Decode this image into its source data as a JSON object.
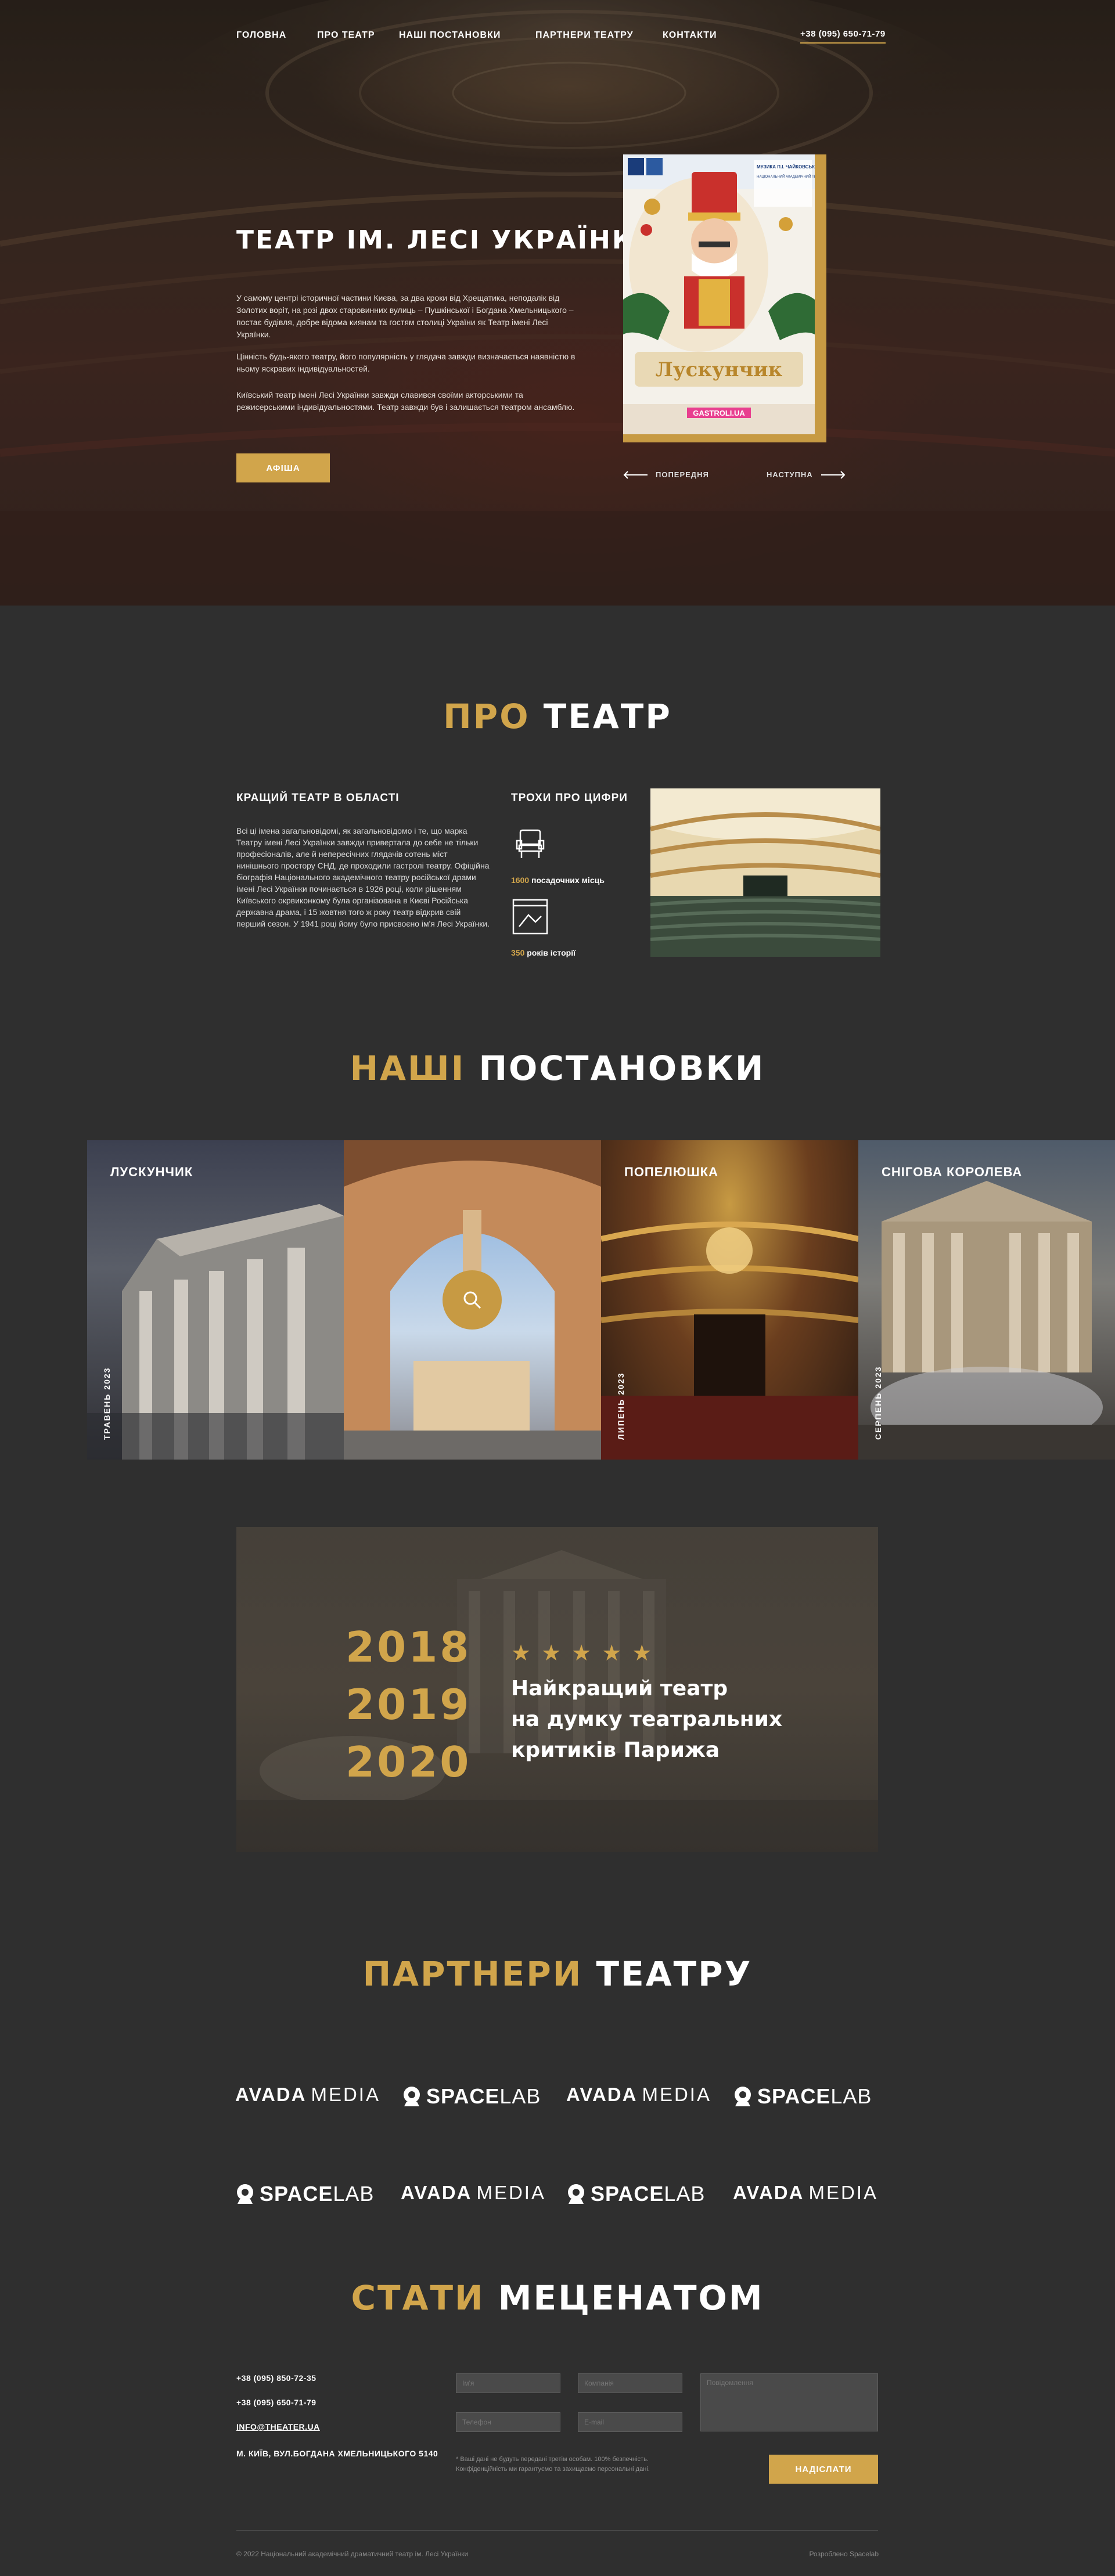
{
  "nav": {
    "items": [
      "ГОЛОВНА",
      "ПРО ТЕАТР",
      "НАШІ ПОСТАНОВКИ",
      "ПАРТНЕРИ ТЕАТРУ",
      "КОНТАКТИ"
    ],
    "phone": "+38 (095) 650-71-79"
  },
  "hero": {
    "title": "ТЕАТР ІМ. ЛЕСІ УКРАЇНКИ",
    "p1": "У самому центрі історичної частини Києва, за два кроки від Хрещатика, неподалік від Золотих воріт, на розі двох старовинних вулиць – Пушкінської і Богдана Хмельницького – постає будівля, добре відома киянам та гостям столиці України як Театр імені Лесі Українки.",
    "p2": "Цінність будь-якого театру, його популярність у глядача завжди визначається наявністю в ньому яскравих індивідуальностей.",
    "p3": "Київський театр імені Лесі Українки завжди славився своїми акторськими та режисерськими індивідуальностями. Театр завжди був і залишається театром ансамблю.",
    "button": "АФІША",
    "prev": "ПОПЕРЕДНЯ",
    "next": "НАСТУПНА",
    "poster": {
      "title": "Лускунчик",
      "top_left": "МУЗИКА П.І. ЧАЙКОВСЬКОГО",
      "block1": "НАЦІОНАЛЬНИЙ АКАДЕМІЧНИЙ ТЕАТР",
      "site": "GASTROLI.UA"
    }
  },
  "about": {
    "title_accent": "ПРО",
    "title_rest": "ТЕАТР",
    "col1_head": "КРАЩИЙ ТЕАТР В ОБЛАСТІ",
    "col1_text": "Всі ці імена загальновідомі, як загальновідомо і те, що марка Театру імені Лесі Українки завжди приверта­ла до себе не тільки професіоналів, але й непересічних глядачів сотень міст нинішнього простору СНД, де проходили гастролі театру. Офіційна біографія Національного академічного театру російської драми імені Лесі Українки починається в 1926 році, коли рішенням Київського окрвиконкому була організована в Києві Російська державна драма, і 15 жовтня того ж року театр відкрив свій перший сезон. У 1941 році йому було присвоєно ім'я Лесі Українки.",
    "col2_head": "ТРОХИ ПРО ЦИФРИ",
    "stat1_num": "1600",
    "stat1_label": "посадочних місць",
    "stat2_num": "350",
    "stat2_label": "років історії"
  },
  "shows": {
    "title_accent": "НАШІ",
    "title_rest": "ПОСТАНОВКИ",
    "items": [
      {
        "title": "ЛУСКУНЧИК",
        "date": "ТРАВЕНЬ 2023"
      },
      {
        "title": "",
        "date": ""
      },
      {
        "title": "ПОПЕЛЮШКА",
        "date": "ЛИПЕНЬ 2023"
      },
      {
        "title": "СНІГОВА КОРОЛЕВА",
        "date": "СЕРПЕНЬ 2023"
      }
    ]
  },
  "award": {
    "years": [
      "2018",
      "2019",
      "2020"
    ],
    "stars": "★★★★★",
    "line1": "Найкращий театр",
    "line2": "на думку театральних",
    "line3": "критиків Парижа"
  },
  "partners": {
    "title_accent": "ПАРТНЕРИ",
    "title_rest": "ТЕАТРУ",
    "avada": "AVADA",
    "media": "MEDIA",
    "space": "SPACE",
    "lab": "LAB"
  },
  "patron": {
    "title_accent": "СТАТИ",
    "title_rest": "МЕЦЕНАТОМ",
    "phone1": "+38 (095) 850-72-35",
    "phone2": "+38 (095) 650-71-79",
    "email": "INFO@THEATER.UA",
    "address": "М. КИЇВ, ВУЛ.БОГДАНА ХМЕЛЬНИЦЬКОГО 5140",
    "ph_name": "Ім'я",
    "ph_company": "Компанія",
    "ph_message": "Повідомлення",
    "ph_phone": "Телефон",
    "ph_email": "E-mail",
    "note": "* Ваші дані не будуть передані третім особам. 100% безпечність. Конфіденційність ми гарантуємо та захищаємо персональні дані.",
    "submit": "НАДІСЛАТИ"
  },
  "footer": {
    "copyright": "© 2022 Національний академічний драматичний театр ім. Лесі Українки",
    "dev": "Розроблено Spacelab"
  },
  "colors": {
    "accent": "#d1a54b",
    "bg": "#2f2f2f"
  }
}
